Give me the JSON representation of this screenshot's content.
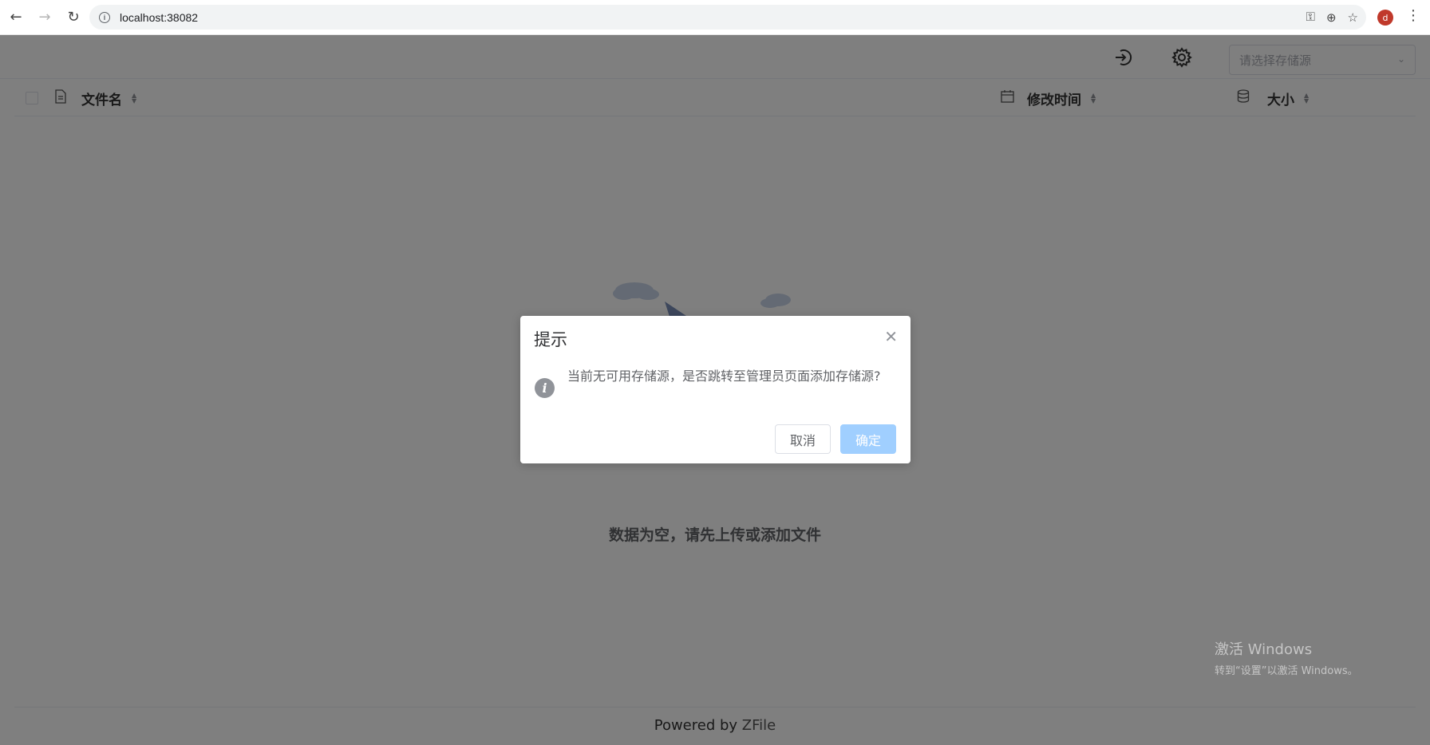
{
  "browser": {
    "url": "localhost:38082",
    "profile_initial": "d"
  },
  "toolbar": {
    "storage_select_placeholder": "请选择存储源"
  },
  "table": {
    "columns": [
      {
        "label": "文件名"
      },
      {
        "label": "修改时间"
      },
      {
        "label": "大小"
      }
    ]
  },
  "empty": {
    "text": "数据为空，请先上传或添加文件"
  },
  "footer": {
    "prefix": "Powered by ",
    "brand": "ZFile"
  },
  "watermark": {
    "line1": "激活 Windows",
    "line2": "转到“设置”以激活 Windows。"
  },
  "dialog": {
    "title": "提示",
    "message": "当前无可用存储源，是否跳转至管理员页面添加存储源?",
    "cancel_label": "取消",
    "confirm_label": "确定"
  },
  "colors": {
    "primary_disabled": "#a0cfff",
    "info_icon": "#909399"
  }
}
